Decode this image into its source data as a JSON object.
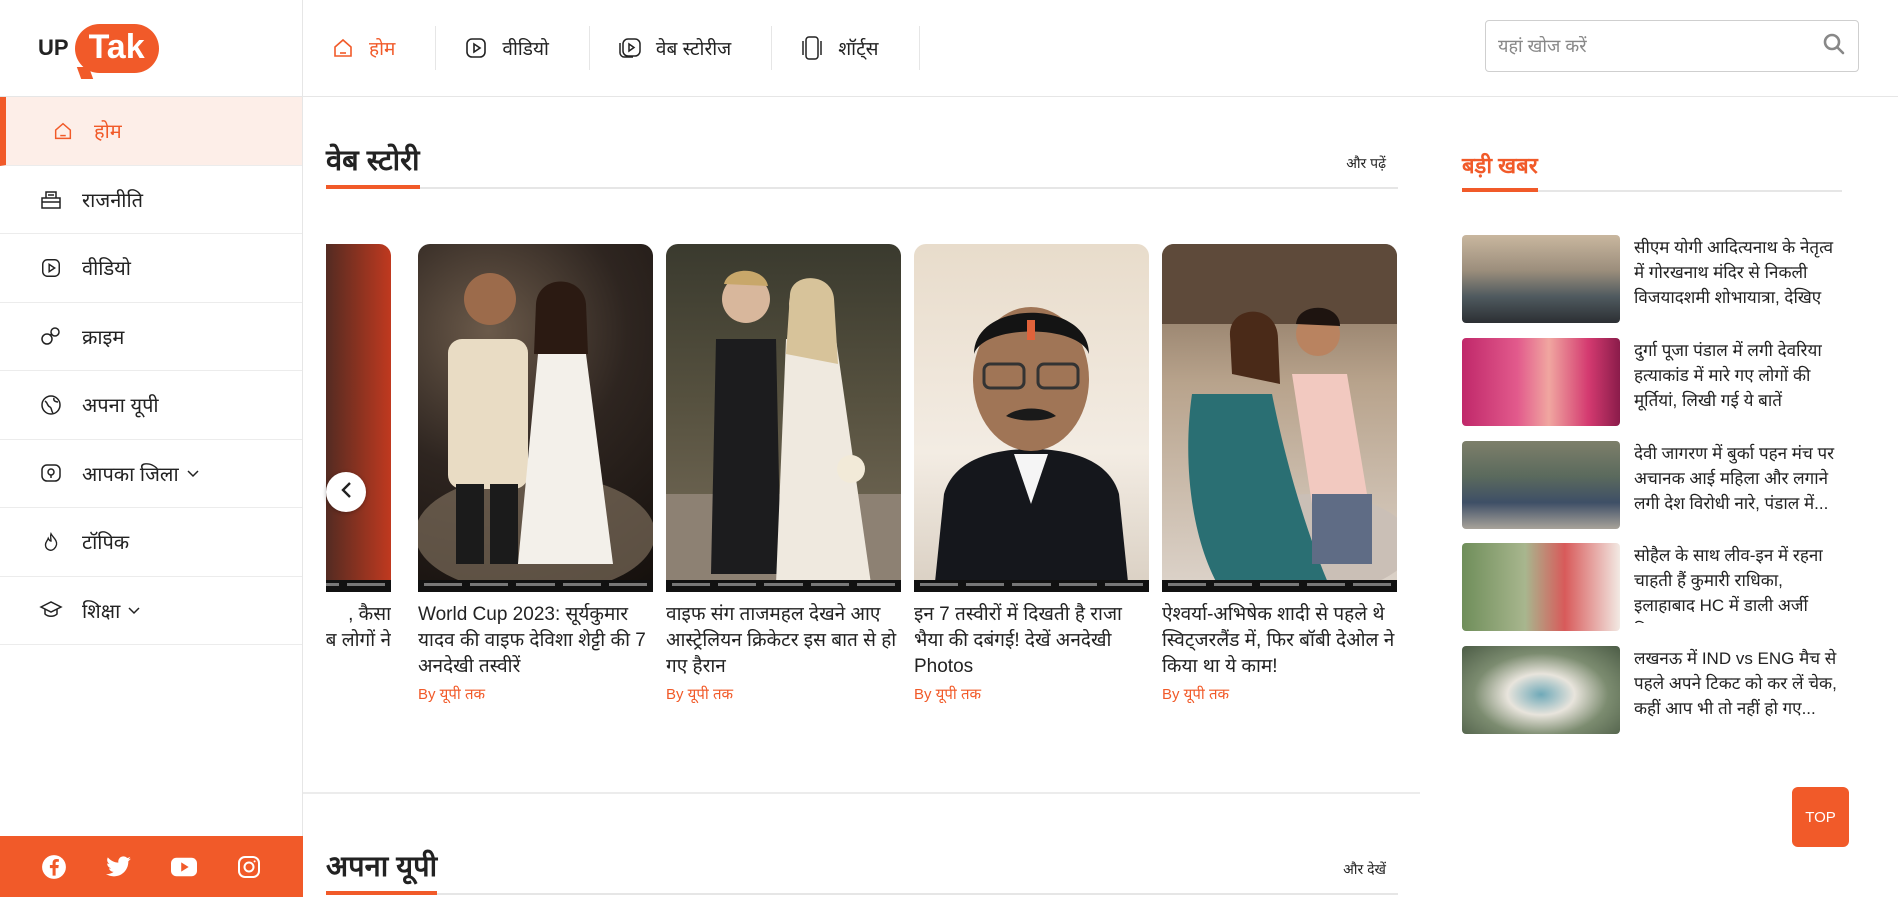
{
  "logo": {
    "up": "UP",
    "tak": "Tak"
  },
  "sidebar": {
    "items": [
      {
        "label": "होम",
        "icon": "home-icon",
        "active": true
      },
      {
        "label": "राजनीति",
        "icon": "ballot-box-icon"
      },
      {
        "label": "वीडियो",
        "icon": "video-play-icon"
      },
      {
        "label": "क्राइम",
        "icon": "handcuffs-icon"
      },
      {
        "label": "अपना यूपी",
        "icon": "globe-icon"
      },
      {
        "label": "आपका जिला",
        "icon": "district-icon",
        "dropdown": true
      },
      {
        "label": "टॉपिक",
        "icon": "flame-icon"
      },
      {
        "label": "शिक्षा",
        "icon": "graduation-cap-icon",
        "dropdown": true
      }
    ],
    "social": [
      "facebook-icon",
      "twitter-icon",
      "youtube-icon",
      "instagram-icon"
    ]
  },
  "topnav": {
    "tabs": [
      {
        "label": "होम",
        "icon": "home-icon",
        "active": true
      },
      {
        "label": "वीडियो",
        "icon": "video-play-icon"
      },
      {
        "label": "वेब स्टोरीज",
        "icon": "web-stories-icon"
      },
      {
        "label": "शॉर्ट्स",
        "icon": "shorts-icon"
      }
    ],
    "search_placeholder": "यहां खोज करें"
  },
  "web_stories": {
    "title": "वेब स्टोरी",
    "more": "और पढ़ें",
    "partial_story": {
      "title_line1": ", कैसा",
      "title_line2": "ब लोगों ने"
    },
    "stories": [
      {
        "title": "World Cup 2023: सूर्यकुमार यादव की वाइफ देविशा शेट्टी की 7 अनदेखी तस्वीरें",
        "byline": "By यूपी तक"
      },
      {
        "title": "वाइफ संग ताजमहल देखने आए आस्ट्रेलियन क्रिकेटर इस बात से हो गए हैरान",
        "byline": "By यूपी तक"
      },
      {
        "title": "इन 7 तस्वीरों में दिखती है राजा भैया की दबंगई! देखें अनदेखी Photos",
        "byline": "By यूपी तक"
      },
      {
        "title": "ऐश्वर्या-अभिषेक शादी से पहले थे स्विट्जरलैंड में, फिर बॉबी देओल ने किया था ये काम!",
        "byline": "By यूपी तक"
      }
    ]
  },
  "apna_up": {
    "title": "अपना यूपी",
    "more": "और देखें"
  },
  "badi_khabar": {
    "title": "बड़ी खबर",
    "items": [
      {
        "text": "सीएम योगी आदित्यनाथ के नेतृत्व में गोरखनाथ मंदिर से निकली विजयादशमी शोभायात्रा, देखिए"
      },
      {
        "text": "दुर्गा पूजा पंडाल में लगी देवरिया हत्याकांड में मारे गए लोगों की मूर्तियां, लिखी गई ये बातें"
      },
      {
        "text": "देवी जागरण में बुर्का पहन मंच पर अचानक आई महिला और लगाने लगी देश विरोधी नारे, पंडाल में..."
      },
      {
        "text": "सोहैल के साथ लीव-इन में रहना चाहती हैं कुमारी राधिका, इलाहाबाद HC में डाली अर्जी फि..."
      },
      {
        "text": "लखनऊ में IND vs ENG मैच से पहले अपने टिकट को कर लें चेक, कहीं आप भी तो नहीं हो गए..."
      }
    ]
  },
  "top_button": "TOP",
  "colors": {
    "accent": "#f15a29",
    "active_bg": "#fdeee8"
  }
}
